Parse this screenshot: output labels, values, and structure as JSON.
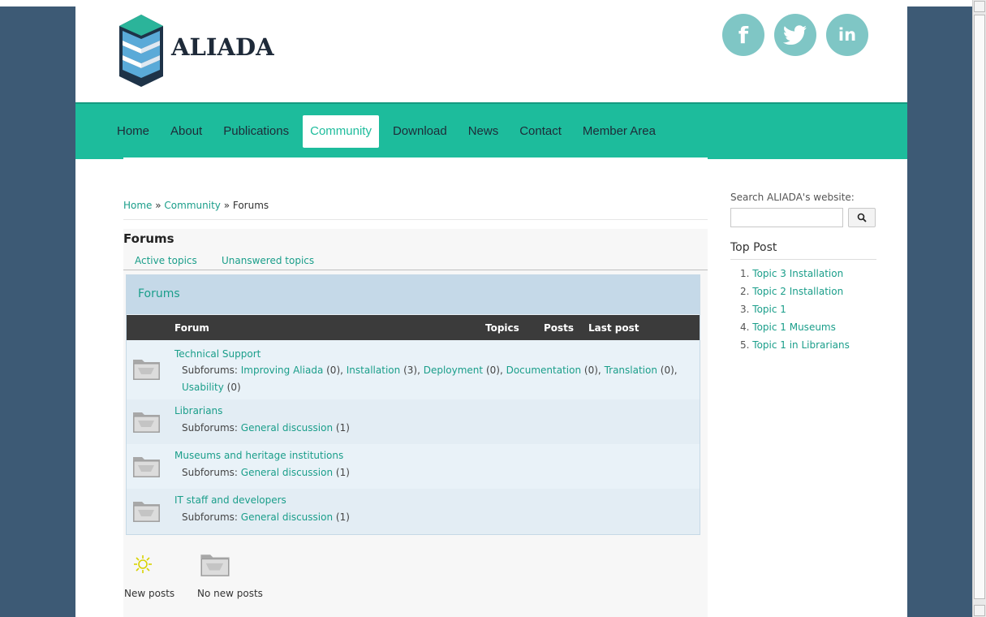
{
  "site": {
    "name": "ALIADA"
  },
  "social": [
    {
      "label": "f",
      "icon": "facebook-icon"
    },
    {
      "label": "",
      "icon": "twitter-icon"
    },
    {
      "label": "in",
      "icon": "linkedin-icon"
    }
  ],
  "nav": {
    "items": [
      "Home",
      "About",
      "Publications",
      "Community",
      "Download",
      "News",
      "Contact",
      "Member Area"
    ],
    "active": "Community"
  },
  "breadcrumb": {
    "home": "Home",
    "sep": " » ",
    "community": "Community",
    "current": "Forums"
  },
  "page": {
    "title": "Forums"
  },
  "tabs": {
    "active_topics": "Active topics",
    "unanswered_topics": "Unanswered topics"
  },
  "forum_box": {
    "heading": "Forums",
    "columns": {
      "forum": "Forum",
      "topics": "Topics",
      "posts": "Posts",
      "last_post": "Last post"
    },
    "subforums_label": "Subforums:",
    "rows": [
      {
        "title": "Technical Support",
        "subforums": [
          {
            "name": "Improving Aliada",
            "count": "(0)"
          },
          {
            "name": "Installation",
            "count": "(3)"
          },
          {
            "name": "Deployment",
            "count": "(0)"
          },
          {
            "name": "Documentation",
            "count": "(0)"
          },
          {
            "name": "Translation",
            "count": "(0)"
          },
          {
            "name": "Usability",
            "count": "(0)"
          }
        ]
      },
      {
        "title": "Librarians",
        "subforums": [
          {
            "name": "General discussion",
            "count": "(1)"
          }
        ]
      },
      {
        "title": "Museums and heritage institutions",
        "subforums": [
          {
            "name": "General discussion",
            "count": "(1)"
          }
        ]
      },
      {
        "title": "IT staff and developers",
        "subforums": [
          {
            "name": "General discussion",
            "count": "(1)"
          }
        ]
      }
    ]
  },
  "legend": {
    "new_posts": "New posts",
    "no_new_posts": "No new posts"
  },
  "sidebar": {
    "search_label": "Search ALIADA's website:",
    "search_placeholder": "",
    "top_post_title": "Top Post",
    "top_posts": [
      {
        "num": "1.",
        "label": "Topic 3 Installation"
      },
      {
        "num": "2.",
        "label": "Topic 2 Installation"
      },
      {
        "num": "3.",
        "label": "Topic 1"
      },
      {
        "num": "4.",
        "label": "Topic 1 Museums"
      },
      {
        "num": "5.",
        "label": "Topic 1 in Librarians"
      }
    ]
  },
  "colors": {
    "accent": "#1dbc9c",
    "link": "#1a9e8a",
    "background": "#3d5a75",
    "social": "#7fc6c5"
  }
}
